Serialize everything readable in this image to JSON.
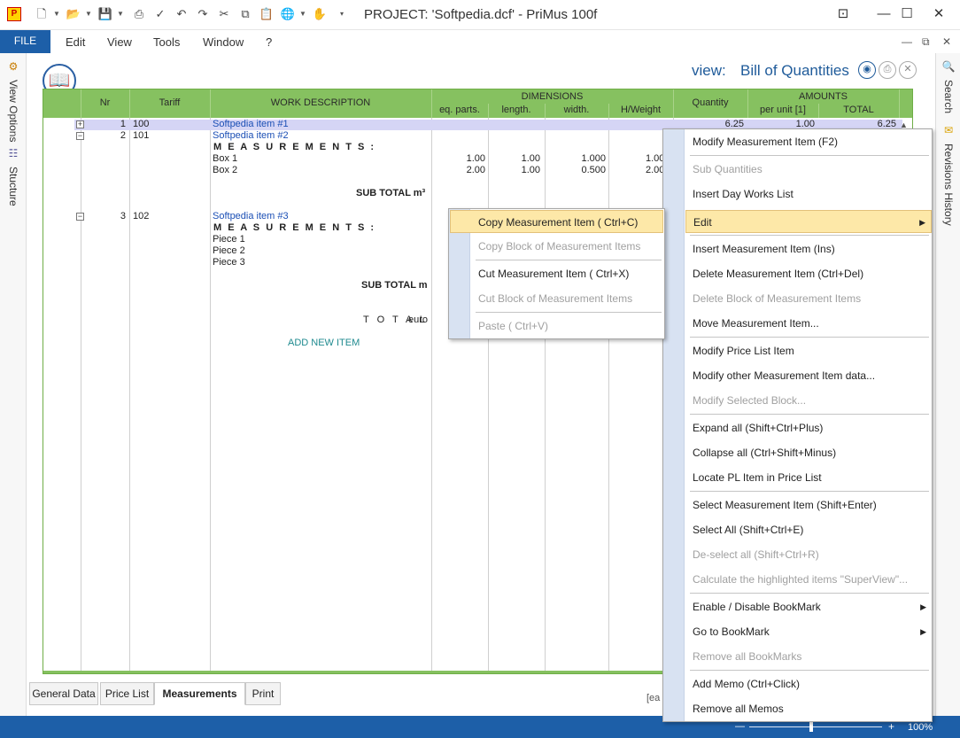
{
  "window": {
    "title": "PROJECT: 'Softpedia.dcf' - PriMus      100f"
  },
  "menu": {
    "file": "FILE",
    "items": [
      "Edit",
      "View",
      "Tools",
      "Window",
      "?"
    ]
  },
  "left_panel": {
    "view_options": "View Options",
    "structure": "Stucture"
  },
  "right_panel": {
    "search": "Search",
    "revisions": "Revisions History"
  },
  "view_header": {
    "label": "view:",
    "name": "Bill of Quantities"
  },
  "grid": {
    "headers": {
      "nr": "Nr",
      "tariff": "Tariff",
      "work": "WORK DESCRIPTION",
      "dimensions": "DIMENSIONS",
      "eq_parts": "eq. parts.",
      "length": "length.",
      "width": "width.",
      "hweight": "H/Weight",
      "quantity": "Quantity",
      "amounts": "AMOUNTS",
      "per_unit": "per unit [1]",
      "total": "TOTAL"
    },
    "rows": {
      "r1_nr": "1",
      "r1_tariff": "100",
      "r1_desc": "Softpedia item #1",
      "r1_quantity": "6.25",
      "r1_unit": "1.00",
      "r1_total": "6.25",
      "r2_nr": "2",
      "r2_tariff": "101",
      "r2_desc": "Softpedia item #2",
      "meas_label": "M E A S U R E M E N T S :",
      "box1": "Box 1",
      "box1_eq": "1.00",
      "box1_len": "1.00",
      "box1_wid": "1.000",
      "box1_h": "1.00",
      "box2": "Box 2",
      "box2_eq": "2.00",
      "box2_len": "1.00",
      "box2_wid": "0.500",
      "box2_h": "2.00",
      "subtot1": "SUB TOTAL m³",
      "r3_nr": "3",
      "r3_tariff": "102",
      "r3_desc": "Softpedia item #3",
      "meas_label2": "M E A S U R E M E N T S :",
      "piece1": "Piece 1",
      "piece2": "Piece 2",
      "piece3": "Piece 3",
      "subtot2": "SUB TOTAL m",
      "total_label": "T O T A L",
      "total_unit": "euro",
      "add_new": "ADD NEW ITEM"
    }
  },
  "tabs": [
    "General Data",
    "Price List",
    "Measurements",
    "Print"
  ],
  "status": {
    "zoom": "100%",
    "partial_text": "[ea"
  },
  "context_menu": {
    "items": [
      {
        "label": "Modify Measurement Item   (F2)",
        "disabled": false
      },
      {
        "label": "Sub Quantities",
        "disabled": true
      },
      {
        "label": "Insert Day Works List",
        "disabled": false
      },
      {
        "label": "Edit",
        "disabled": false
      },
      {
        "label": "Insert Measurement Item   (Ins)",
        "disabled": false
      },
      {
        "label": "Delete Measurement Item    (Ctrl+Del)",
        "disabled": false
      },
      {
        "label": "Delete Block of Measurement Items",
        "disabled": true
      },
      {
        "label": "Move Measurement Item...",
        "disabled": false
      },
      {
        "label": "Modify Price List Item",
        "disabled": false
      },
      {
        "label": "Modify other Measurement Item data...",
        "disabled": false
      },
      {
        "label": "Modify Selected Block...",
        "disabled": true
      },
      {
        "label": "Expand all   (Shift+Ctrl+Plus)",
        "disabled": false
      },
      {
        "label": "Collapse all   (Ctrl+Shift+Minus)",
        "disabled": false
      },
      {
        "label": "Locate PL Item in Price List",
        "disabled": false
      },
      {
        "label": "Select Measurement Item   (Shift+Enter)",
        "disabled": false
      },
      {
        "label": "Select All   (Shift+Ctrl+E)",
        "disabled": false
      },
      {
        "label": "De-select all      (Shift+Ctrl+R)",
        "disabled": true
      },
      {
        "label": "Calculate the highlighted items \"SuperView\"...",
        "disabled": true
      },
      {
        "label": "Enable / Disable BookMark",
        "disabled": false
      },
      {
        "label": "Go to BookMark",
        "disabled": false
      },
      {
        "label": "Remove all BookMarks",
        "disabled": true
      },
      {
        "label": "Add Memo      (Ctrl+Click)",
        "disabled": false
      },
      {
        "label": "Remove all Memos",
        "disabled": false
      }
    ]
  },
  "submenu": {
    "items": [
      {
        "label": "Copy Measurement Item ( Ctrl+C)",
        "disabled": false
      },
      {
        "label": "Copy Block of Measurement Items",
        "disabled": true
      },
      {
        "label": "Cut Measurement Item ( Ctrl+X)",
        "disabled": false
      },
      {
        "label": "Cut Block of Measurement Items",
        "disabled": true
      },
      {
        "label": "Paste ( Ctrl+V)",
        "disabled": true
      }
    ]
  }
}
